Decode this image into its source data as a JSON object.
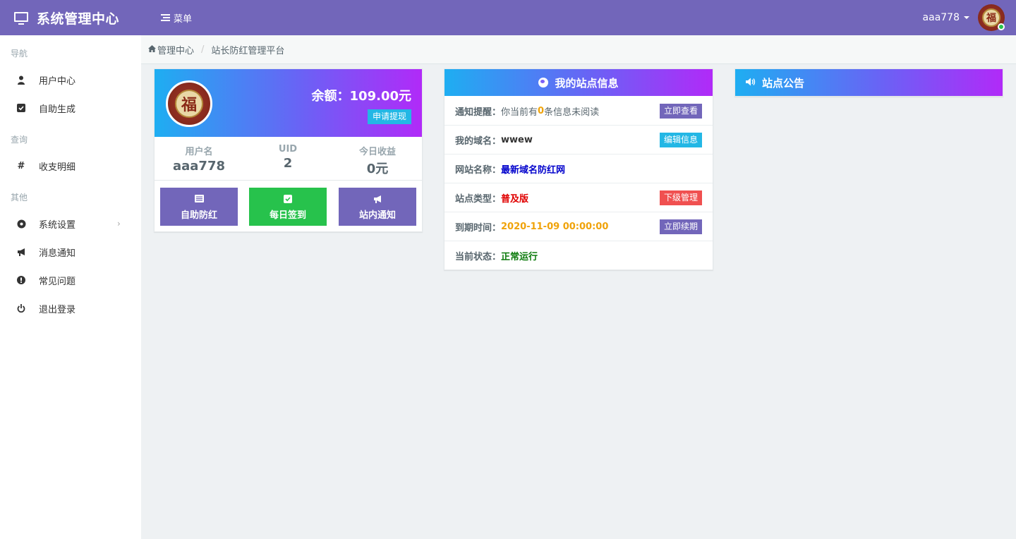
{
  "header": {
    "app_title": "系统管理中心",
    "menu_label": "菜单",
    "username": "aaa778",
    "avatar_glyph": "福",
    "bg_color": "#7266ba"
  },
  "sidebar": {
    "sections": [
      {
        "title": "导航",
        "items": [
          {
            "label": "用户中心",
            "icon": "user-icon"
          },
          {
            "label": "自助生成",
            "icon": "checkbox-icon"
          }
        ]
      },
      {
        "title": "查询",
        "items": [
          {
            "label": "收支明细",
            "icon": "hash-icon"
          }
        ]
      },
      {
        "title": "其他",
        "items": [
          {
            "label": "系统设置",
            "icon": "settings-icon"
          },
          {
            "label": "消息通知",
            "icon": "megaphone-icon"
          },
          {
            "label": "常见问题",
            "icon": "exclamation-icon"
          },
          {
            "label": "退出登录",
            "icon": "power-icon"
          }
        ]
      }
    ]
  },
  "breadcrumb": {
    "home": "管理中心",
    "current": "站长防红管理平台"
  },
  "user_card": {
    "avatar_glyph": "福",
    "balance": "余额：109.00元",
    "withdraw_label": "申请提现",
    "stats": [
      {
        "label": "用户名",
        "value": "aaa778"
      },
      {
        "label": "UID",
        "value": "2"
      },
      {
        "label": "今日收益",
        "value": "0元"
      }
    ],
    "buttons": [
      {
        "label": "自助防红",
        "icon": "list-icon",
        "color": "#7266ba"
      },
      {
        "label": "每日签到",
        "icon": "checkbox-icon",
        "color": "#27c24c"
      },
      {
        "label": "站内通知",
        "icon": "megaphone-icon",
        "color": "#7266ba"
      }
    ]
  },
  "site_info": {
    "title": "我的站点信息",
    "rows": {
      "notify": {
        "key": "通知提醒：",
        "pre": "你当前有",
        "count": "0",
        "post": "条信息未阅读",
        "button": "立即查看",
        "button_color": "#7266ba",
        "count_color": "#f0a30a"
      },
      "domain": {
        "key": "我的域名：",
        "value": "wwew",
        "button": "编辑信息",
        "button_color": "#23b7e5",
        "value_color": "#58666e"
      },
      "site_name": {
        "key": "网站名称：",
        "value": "最新域名防红网",
        "value_color": "#0000cc"
      },
      "site_type": {
        "key": "站点类型：",
        "value": "普及版",
        "button": "下级管理",
        "button_color": "#f05050",
        "value_color": "#e00000"
      },
      "expire": {
        "key": "到期时间：",
        "value": "2020-11-09 00:00:00",
        "button": "立即续期",
        "button_color": "#7266ba",
        "value_color": "#f0a30a"
      },
      "status": {
        "key": "当前状态：",
        "value": "正常运行",
        "value_color": "#0a7a0a"
      }
    }
  },
  "notice": {
    "title": "站点公告"
  }
}
